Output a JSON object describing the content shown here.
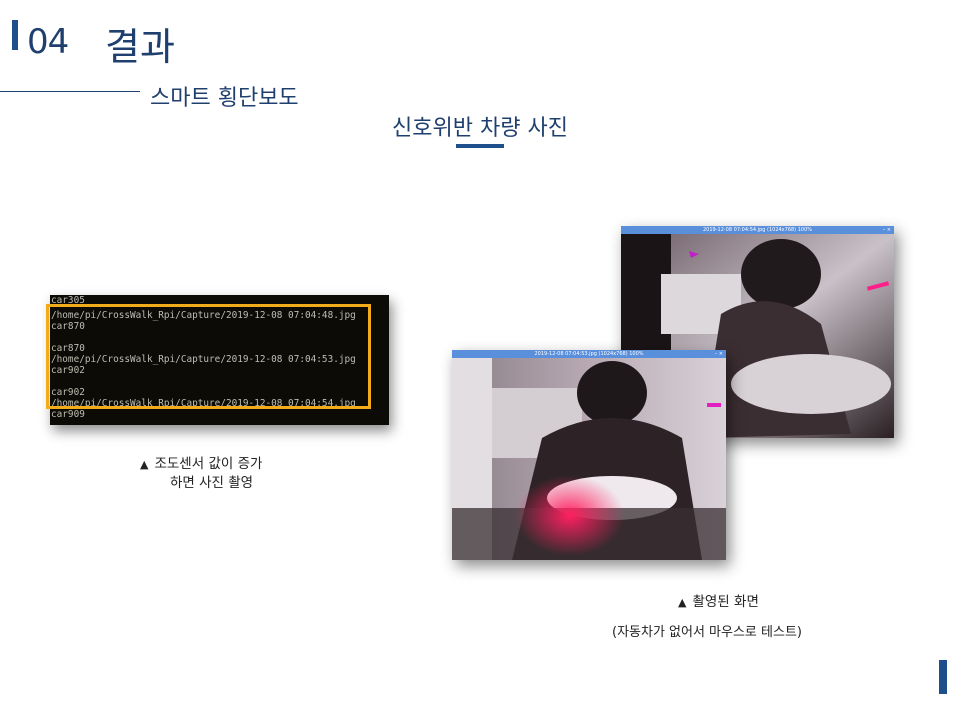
{
  "header": {
    "section_number": "04",
    "section_title": "결과",
    "subtitle": "스마트 횡단보도",
    "heading": "신호위반 차량 사진"
  },
  "terminal": {
    "lines": [
      "car305",
      "/home/pi/CrossWalk_Rpi/Capture/2019-12-08 07:04:48.jpg",
      "car870",
      "",
      "car870",
      "/home/pi/CrossWalk_Rpi/Capture/2019-12-08 07:04:53.jpg",
      "car902",
      "",
      "car902",
      "/home/pi/CrossWalk_Rpi/Capture/2019-12-08 07:04:54.jpg",
      "car909"
    ]
  },
  "caption_left": {
    "line1": "조도센서 값이 증가",
    "line2": "하면 사진 촬영"
  },
  "screenshots": {
    "back_title": "2019-12-08 07:04:54.jpg (1024x768) 100%",
    "front_title": "2019-12-08 07:04:53.jpg (1024x768) 100%"
  },
  "caption_right": {
    "line1": "촬영된 화면",
    "line2": "(자동차가 없어서 마우스로 테스트)"
  },
  "colors": {
    "accent": "#1f4e8c",
    "highlight": "#f2ab1a",
    "terminal_bg": "#0d0b05",
    "window_title": "#5a8fdb"
  }
}
